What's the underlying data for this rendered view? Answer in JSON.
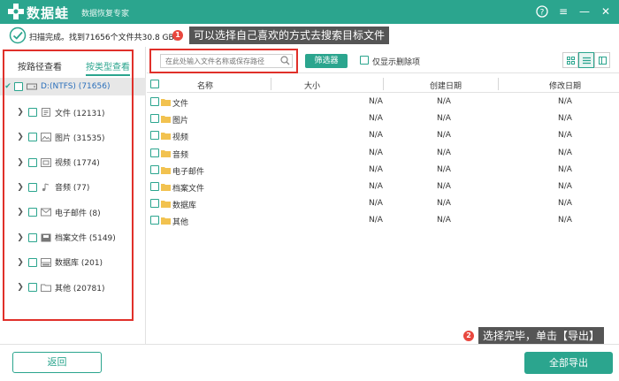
{
  "titlebar": {
    "app_name": "数据蛙",
    "subtitle": "数据恢复专家",
    "help_icon": "?",
    "menu_icon": "≡",
    "min_icon": "—",
    "close_icon": "✕"
  },
  "status": {
    "scan_text": "扫描完成。找到71656个文件共30.8 GB。"
  },
  "tips": [
    {
      "num": "1",
      "text": "可以选择自己喜欢的方式去搜索目标文件"
    },
    {
      "num": "2",
      "text": "选择完毕，单击【导出】"
    }
  ],
  "view_tabs": {
    "by_path": "按路径查看",
    "by_type": "按类型查看"
  },
  "tree": {
    "root": {
      "label": "D:(NTFS) (71656)"
    },
    "items": [
      {
        "label": "文件 (12131)",
        "icon": "document-icon"
      },
      {
        "label": "图片 (31535)",
        "icon": "image-icon"
      },
      {
        "label": "视频 (1774)",
        "icon": "video-icon"
      },
      {
        "label": "音频 (77)",
        "icon": "audio-icon"
      },
      {
        "label": "电子邮件 (8)",
        "icon": "email-icon"
      },
      {
        "label": "档案文件 (5149)",
        "icon": "archive-icon"
      },
      {
        "label": "数据库 (201)",
        "icon": "database-icon"
      },
      {
        "label": "其他 (20781)",
        "icon": "folder-icon"
      }
    ]
  },
  "toolbar": {
    "search_placeholder": "在此处输入文件名称或保存路径",
    "filter_label": "筛选器",
    "deleted_only_label": "仅显示删除项"
  },
  "grid": {
    "columns": [
      "名称",
      "大小",
      "创建日期",
      "修改日期"
    ],
    "rows": [
      {
        "name": "文件",
        "size": "N/A",
        "created": "N/A",
        "modified": "N/A"
      },
      {
        "name": "图片",
        "size": "N/A",
        "created": "N/A",
        "modified": "N/A"
      },
      {
        "name": "视频",
        "size": "N/A",
        "created": "N/A",
        "modified": "N/A"
      },
      {
        "name": "音频",
        "size": "N/A",
        "created": "N/A",
        "modified": "N/A"
      },
      {
        "name": "电子邮件",
        "size": "N/A",
        "created": "N/A",
        "modified": "N/A"
      },
      {
        "name": "档案文件",
        "size": "N/A",
        "created": "N/A",
        "modified": "N/A"
      },
      {
        "name": "数据库",
        "size": "N/A",
        "created": "N/A",
        "modified": "N/A"
      },
      {
        "name": "其他",
        "size": "N/A",
        "created": "N/A",
        "modified": "N/A"
      }
    ]
  },
  "footer": {
    "back_label": "返回",
    "export_label": "全部导出"
  },
  "colors": {
    "accent": "#2ba58e",
    "tip_bg": "#555555",
    "badge": "#e8473e",
    "highlight_box": "#e0302a"
  }
}
